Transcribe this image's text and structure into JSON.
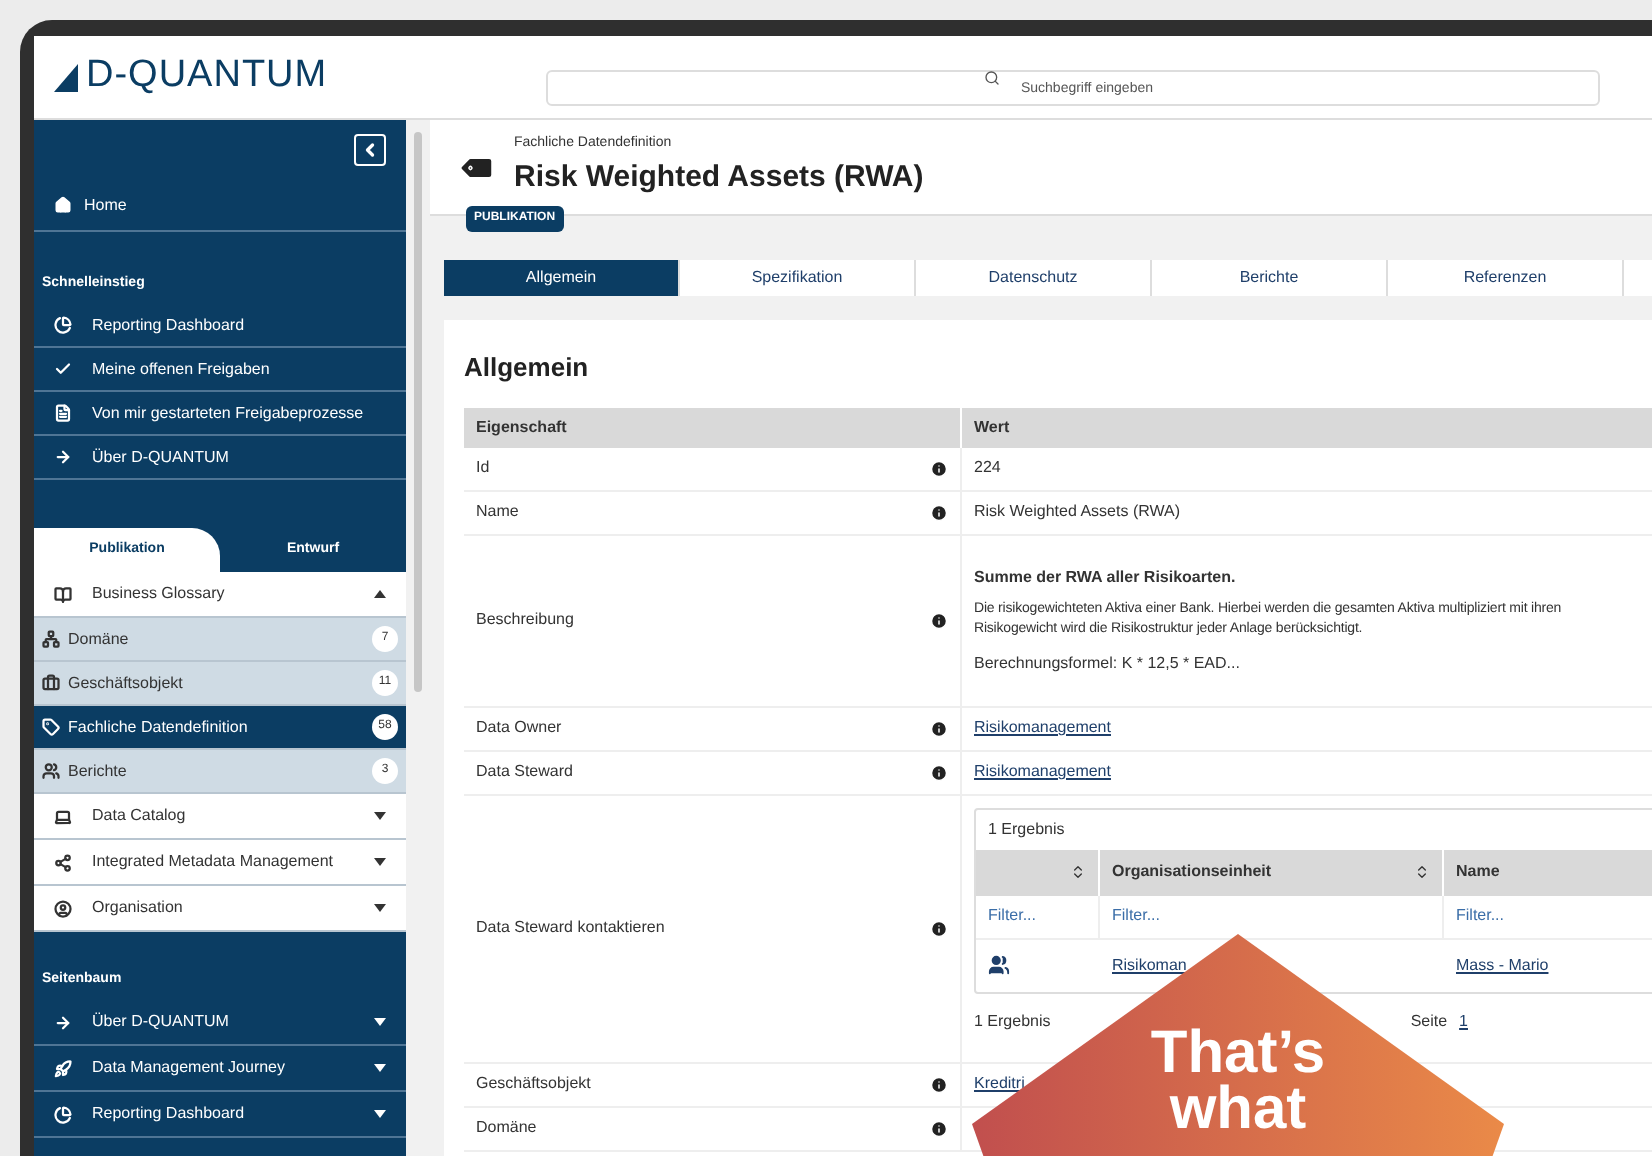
{
  "header": {
    "logo": "D-QUANTUM",
    "search": {
      "placeholder": "Suchbegriff eingeben"
    }
  },
  "sidebar": {
    "home": "Home",
    "quick_access": {
      "title": "Schnelleinstieg",
      "items": [
        "Reporting Dashboard",
        "Meine offenen Freigaben",
        "Von mir gestarteten Freigabeprozesse",
        "Über D-QUANTUM"
      ]
    },
    "mode_tabs": [
      {
        "label": "Publikation",
        "selected": true
      },
      {
        "label": "Entwurf",
        "selected": false
      }
    ],
    "catalog": [
      {
        "label": "Business Glossary",
        "expanded": true,
        "children": [
          {
            "label": "Domäne",
            "count": "7",
            "selected": false
          },
          {
            "label": "Geschäftsobjekt",
            "count": "11",
            "selected": false
          },
          {
            "label": "Fachliche Datendefinition",
            "count": "58",
            "selected": true
          },
          {
            "label": "Berichte",
            "count": "3",
            "selected": false
          }
        ]
      },
      {
        "label": "Data Catalog",
        "expanded": false
      },
      {
        "label": "Integrated Metadata Management",
        "expanded": false
      },
      {
        "label": "Organisation",
        "expanded": false
      }
    ],
    "site_tree": {
      "title": "Seitenbaum",
      "items": [
        {
          "label": "Über D-QUANTUM",
          "expanded": false
        },
        {
          "label": "Data Management Journey",
          "expanded": false
        },
        {
          "label": "Reporting Dashboard",
          "expanded": false
        }
      ]
    }
  },
  "page": {
    "subtitle": "Fachliche Datendefinition",
    "title": "Risk Weighted Assets (RWA)",
    "status": "PUBLIKATION",
    "tabs": [
      {
        "label": "Allgemein",
        "selected": true
      },
      {
        "label": "Spezifikation",
        "selected": false
      },
      {
        "label": "Datenschutz",
        "selected": false
      },
      {
        "label": "Berichte",
        "selected": false
      },
      {
        "label": "Referenzen",
        "selected": false
      }
    ],
    "section_title": "Allgemein",
    "table": {
      "columns": [
        "Eigenschaft",
        "Wert"
      ],
      "rows": [
        {
          "property": "Id",
          "kind": "text",
          "value": "224"
        },
        {
          "property": "Name",
          "kind": "text",
          "value": "Risk Weighted Assets (RWA)"
        },
        {
          "property": "Beschreibung",
          "kind": "description",
          "heading": "Summe der RWA aller Risikoarten.",
          "lines": [
            "Die risikogewichteten Aktiva einer Bank. Hierbei werden die gesamten Aktiva multipliziert mit ihren",
            "Risikogewicht wird die Risikostruktur jeder Anlage berücksichtigt."
          ],
          "formula": "Berechnungsformel: K * 12,5 * EAD..."
        },
        {
          "property": "Data Owner",
          "kind": "link",
          "value": "Risikomanagement"
        },
        {
          "property": "Data Steward",
          "kind": "link",
          "value": "Risikomanagement"
        },
        {
          "property": "Data Steward kontaktieren",
          "kind": "results",
          "count_top": "1 Ergebnis",
          "columns": [
            "Organisationseinheit",
            "Name"
          ],
          "filters": [
            {
              "placeholder": "Filter..."
            },
            {
              "placeholder": "Filter..."
            },
            {
              "placeholder": "Filter..."
            }
          ],
          "row": {
            "unit": "Risikoman",
            "name": "Mass - Mario"
          },
          "count_bottom": "1 Ergebnis",
          "page_label": "Seite",
          "page": "1"
        },
        {
          "property": "Geschäftsobjekt",
          "kind": "link",
          "value": "Kreditri"
        },
        {
          "property": "Domäne",
          "kind": "text"
        }
      ]
    }
  },
  "overlay": {
    "lines": [
      "That’s",
      "what"
    ]
  }
}
